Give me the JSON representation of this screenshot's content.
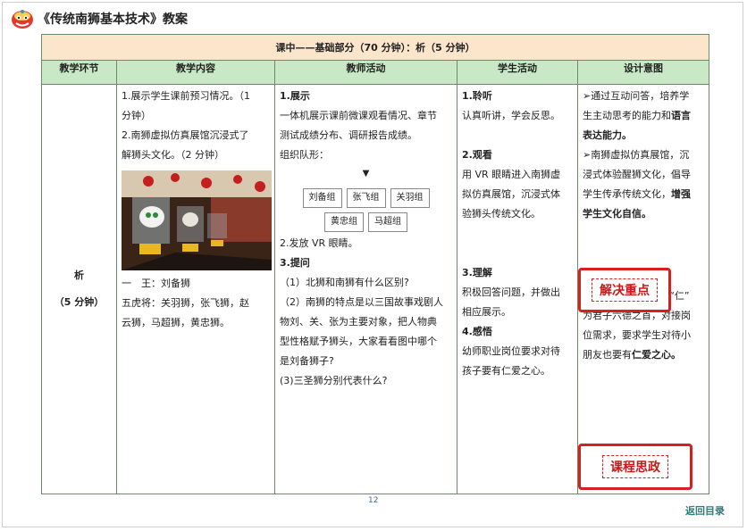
{
  "doc": {
    "title": "《传统南狮基本技术》教案",
    "page_number": "12",
    "back_link": "返回目录"
  },
  "banner": "课中——基础部分（70 分钟）：析（5 分钟）",
  "columns": [
    "教学环节",
    "教学内容",
    "教师活动",
    "学生活动",
    "设计意图"
  ],
  "stage": {
    "name": "析",
    "duration": "（5 分钟）"
  },
  "content": {
    "item1a": "1.展示学生课前预习情况。（1",
    "item1b": "分钟）",
    "item2a": "2.南狮虚拟仿真展馆沉浸式了",
    "item2b": "解狮头文化。（2 分钟）",
    "king": "一　王：刘备狮",
    "tigers1": "五虎将：关羽狮，张飞狮，赵",
    "tigers2": "云狮，马超狮，黄忠狮。"
  },
  "teacher": {
    "h1": "1.展示",
    "p1a": "一体机展示课前微课观看情况、章节",
    "p1b": "测试成绩分布、调研报告成绩。",
    "formation": "组织队形：",
    "arrow": "▼",
    "groups": [
      "刘备组",
      "张飞组",
      "关羽组",
      "黄忠组",
      "马超组"
    ],
    "vr": "2.发放 VR 眼睛。",
    "h3": "3.提问",
    "q1": "（1）北狮和南狮有什么区别?",
    "q2a": "（2）南狮的特点是以三国故事戏剧人",
    "q2b": "物刘、关、张为主要对象，把人物典",
    "q2c": "型性格赋予狮头，大家看看图中哪个",
    "q2d": "是刘备狮子?",
    "q3": "(3)三圣狮分别代表什么?"
  },
  "student": {
    "h1": "1.聆听",
    "p1": "认真听讲，学会反思。",
    "h2": "2.观看",
    "p2a": "用 VR 眼睛进入南狮虚",
    "p2b": "拟仿真展馆，沉浸式体",
    "p2c": "验狮头传统文化。",
    "h3": "3.理解",
    "p3a": "积极回答问题，并做出",
    "p3b": "相应展示。",
    "h4": "4.感悟",
    "p4a": "幼师职业岗位要求对待",
    "p4b": "孩子要有仁爱之心。"
  },
  "design": {
    "l1": "➢通过互动问答，培养学",
    "l2": "生主动思考的能力和",
    "l2b": "语言",
    "l3": "表达能力。",
    "l4": "➢南狮虚拟仿真展馆，沉",
    "l5": "浸式体验醒狮文化，倡导",
    "l6": "学生传承传统文化，",
    "l6b": "增强",
    "l7": "学生文化自信。",
    "stamp1": "解决重点",
    "l8": "➢刘备狮代表仁爱，“仁”",
    "l9": "为君子六德之首，对接岗",
    "l10": "位需求，要求学生对待小",
    "l11": "朋友也要有",
    "l11b": "仁爱之心。",
    "stamp2": "课程思政"
  },
  "colors": {
    "banner_bg": "#fbe6cc",
    "header_bg": "#c9e9c6",
    "border": "#6d8a6a",
    "stamp": "#d62020"
  }
}
